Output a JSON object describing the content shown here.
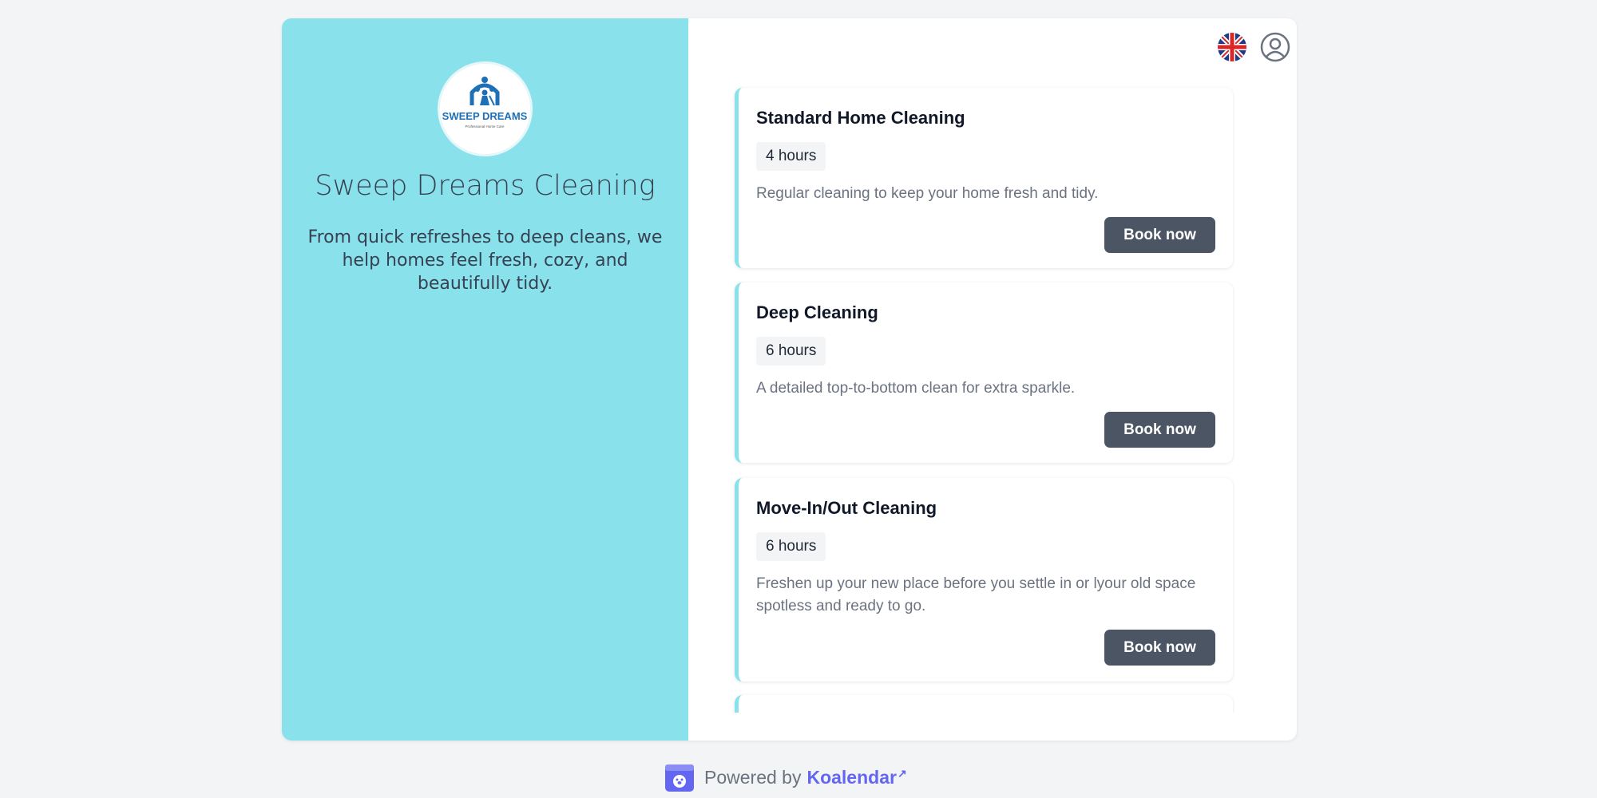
{
  "business": {
    "name": "Sweep Dreams Cleaning",
    "description": "From quick refreshes to deep cleans, we help homes feel fresh, cozy, and beautifully tidy.",
    "logo_text": "SWEEP DREAMS",
    "logo_subtext": "Professional Home Care"
  },
  "header": {
    "language_icon": "uk-flag-icon",
    "account_icon": "user-circle-icon"
  },
  "services": [
    {
      "title": "Standard Home Cleaning",
      "duration": "4 hours",
      "description": "Regular cleaning to keep your home fresh and tidy.",
      "button": "Book now"
    },
    {
      "title": "Deep Cleaning",
      "duration": "6 hours",
      "description": "A detailed top-to-bottom clean for extra sparkle.",
      "button": "Book now"
    },
    {
      "title": "Move-In/Out Cleaning",
      "duration": "6 hours",
      "description": "Freshen up your new place before you settle in or lyour old space spotless and ready to go.",
      "button": "Book now"
    }
  ],
  "footer": {
    "powered_by": "Powered by",
    "brand": "Koalendar"
  },
  "colors": {
    "accent": "#89e1ec",
    "button": "#4b5563",
    "link": "#6366f1"
  }
}
